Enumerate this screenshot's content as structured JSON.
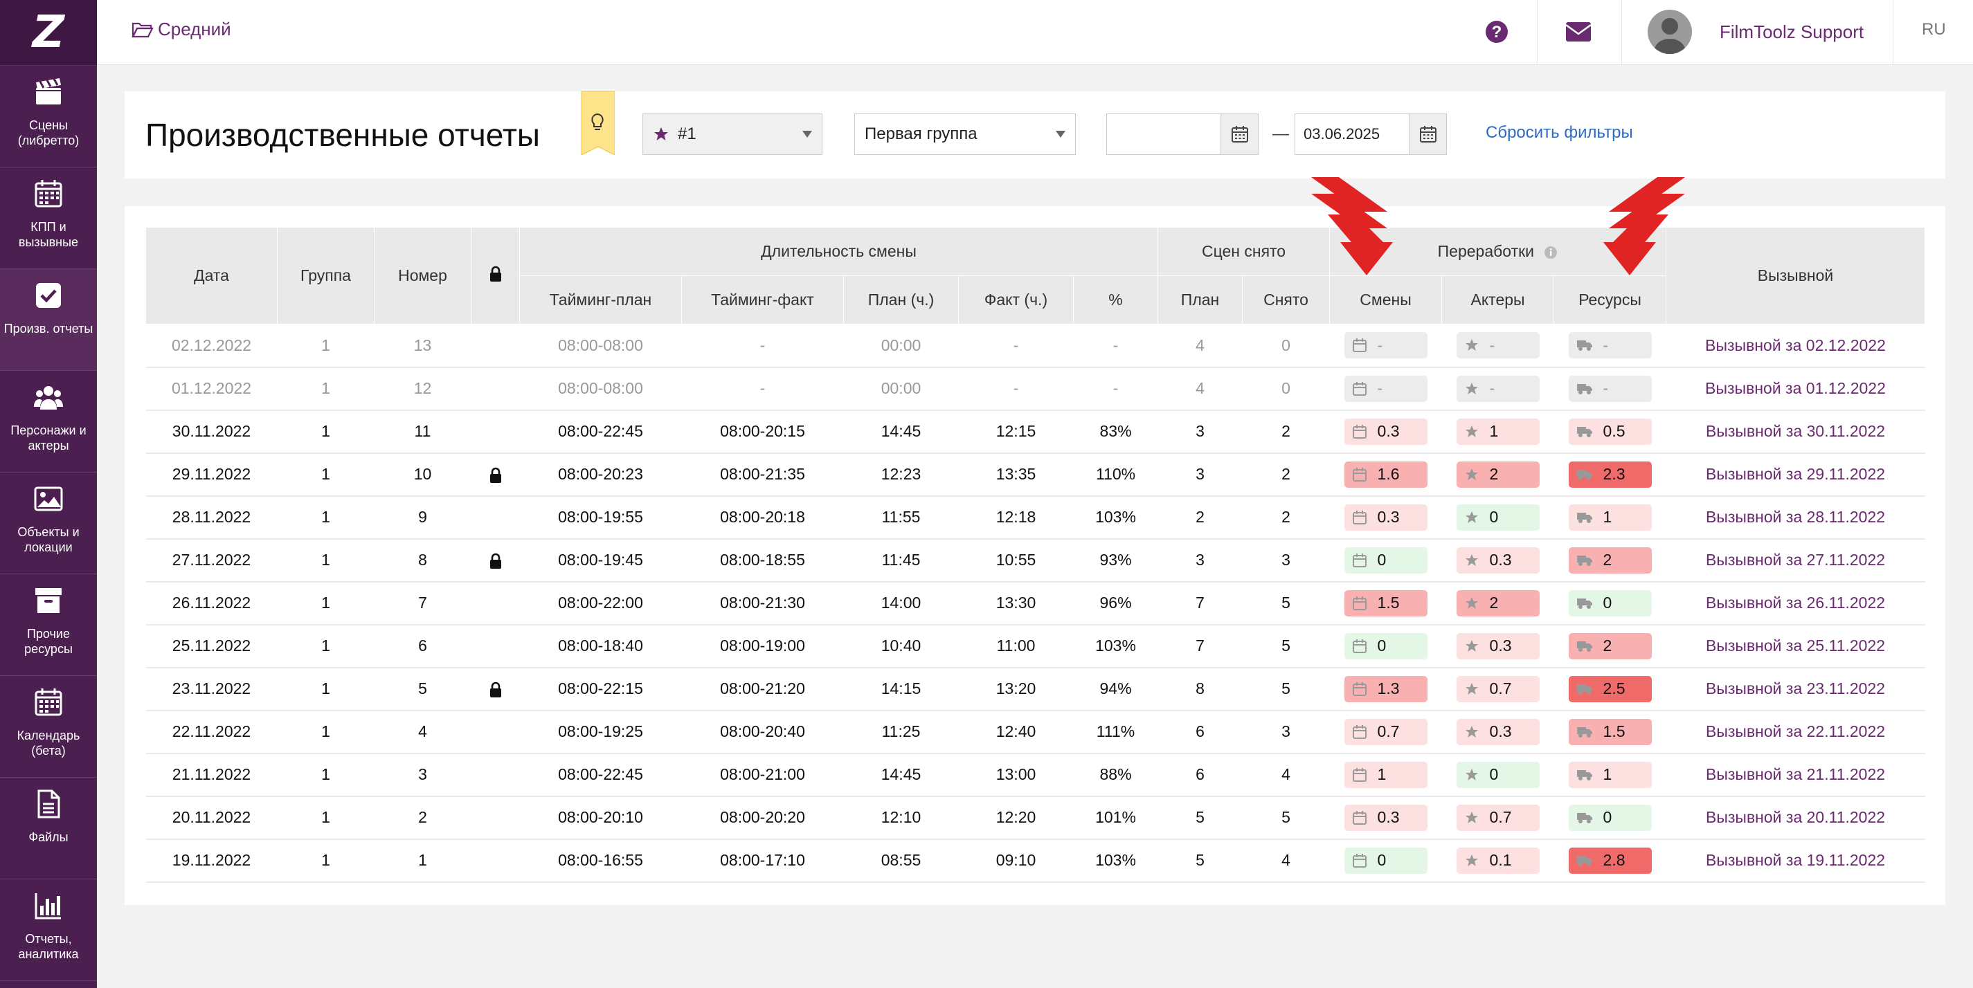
{
  "sidebar": {
    "logo": "Z",
    "items": [
      {
        "label": "Сцены\n(либретто)",
        "icon": "clapperboard-icon"
      },
      {
        "label": "КПП и\nвызывные",
        "icon": "calendar-icon"
      },
      {
        "label": "Произв. отчеты",
        "icon": "checkbox-icon",
        "active": true
      },
      {
        "label": "Персонажи и\nактеры",
        "icon": "people-icon"
      },
      {
        "label": "Объекты и\nлокации",
        "icon": "image-icon"
      },
      {
        "label": "Прочие\nресурсы",
        "icon": "archive-icon"
      },
      {
        "label": "Календарь\n(бета)",
        "icon": "calendar-icon"
      },
      {
        "label": "Файлы",
        "icon": "file-icon"
      },
      {
        "label": "Отчеты,\nаналитика",
        "icon": "bar-chart-icon"
      }
    ]
  },
  "topbar": {
    "project": "Средний",
    "user_name": "FilmToolz Support",
    "lang": "RU"
  },
  "filters": {
    "title": "Производственные отчеты",
    "unit_select": "#1",
    "group_select": "Первая группа",
    "date_from": "",
    "date_to": "03.06.2025",
    "dash": "—",
    "reset": "Сбросить фильтры"
  },
  "table": {
    "headers": {
      "date": "Дата",
      "group": "Группа",
      "number": "Номер",
      "duration": "Длительность смены",
      "timing_plan": "Тайминг-план",
      "timing_fact": "Тайминг-факт",
      "plan_h": "План (ч.)",
      "fact_h": "Факт (ч.)",
      "percent": "%",
      "scenes": "Сцен снято",
      "scenes_plan": "План",
      "scenes_done": "Снято",
      "overtime": "Переработки",
      "ot_shifts": "Смены",
      "ot_actors": "Актеры",
      "ot_resources": "Ресурсы",
      "callsheet": "Вызывной"
    },
    "rows": [
      {
        "date": "02.12.2022",
        "group": "1",
        "number": "13",
        "lock": false,
        "tplan": "08:00-08:00",
        "tfact": "-",
        "plan": "00:00",
        "fact": "-",
        "pct": "-",
        "sp": "4",
        "sd": "0",
        "s": "-",
        "a": "-",
        "r": "-",
        "sl": "gray",
        "al": "gray",
        "rl": "gray",
        "call": "Вызывной за 02.12.2022",
        "muted": true
      },
      {
        "date": "01.12.2022",
        "group": "1",
        "number": "12",
        "lock": false,
        "tplan": "08:00-08:00",
        "tfact": "-",
        "plan": "00:00",
        "fact": "-",
        "pct": "-",
        "sp": "4",
        "sd": "0",
        "s": "-",
        "a": "-",
        "r": "-",
        "sl": "gray",
        "al": "gray",
        "rl": "gray",
        "call": "Вызывной за 01.12.2022",
        "muted": true
      },
      {
        "date": "30.11.2022",
        "group": "1",
        "number": "11",
        "lock": false,
        "tplan": "08:00-22:45",
        "tfact": "08:00-20:15",
        "plan": "14:45",
        "fact": "12:15",
        "pct": "83%",
        "sp": "3",
        "sd": "2",
        "s": "0.3",
        "a": "1",
        "r": "0.5",
        "sl": "light",
        "al": "light",
        "rl": "light",
        "call": "Вызывной за 30.11.2022"
      },
      {
        "date": "29.11.2022",
        "group": "1",
        "number": "10",
        "lock": true,
        "tplan": "08:00-20:23",
        "tfact": "08:00-21:35",
        "plan": "12:23",
        "fact": "13:35",
        "pct": "110%",
        "sp": "3",
        "sd": "2",
        "s": "1.6",
        "a": "2",
        "r": "2.3",
        "sl": "mid",
        "al": "mid",
        "rl": "strong",
        "call": "Вызывной за 29.11.2022"
      },
      {
        "date": "28.11.2022",
        "group": "1",
        "number": "9",
        "lock": false,
        "tplan": "08:00-19:55",
        "tfact": "08:00-20:18",
        "plan": "11:55",
        "fact": "12:18",
        "pct": "103%",
        "sp": "2",
        "sd": "2",
        "s": "0.3",
        "a": "0",
        "r": "1",
        "sl": "light",
        "al": "green",
        "rl": "light",
        "call": "Вызывной за 28.11.2022"
      },
      {
        "date": "27.11.2022",
        "group": "1",
        "number": "8",
        "lock": true,
        "tplan": "08:00-19:45",
        "tfact": "08:00-18:55",
        "plan": "11:45",
        "fact": "10:55",
        "pct": "93%",
        "sp": "3",
        "sd": "3",
        "s": "0",
        "a": "0.3",
        "r": "2",
        "sl": "green",
        "al": "light",
        "rl": "mid",
        "call": "Вызывной за 27.11.2022"
      },
      {
        "date": "26.11.2022",
        "group": "1",
        "number": "7",
        "lock": false,
        "tplan": "08:00-22:00",
        "tfact": "08:00-21:30",
        "plan": "14:00",
        "fact": "13:30",
        "pct": "96%",
        "sp": "7",
        "sd": "5",
        "s": "1.5",
        "a": "2",
        "r": "0",
        "sl": "mid",
        "al": "mid",
        "rl": "green",
        "call": "Вызывной за 26.11.2022"
      },
      {
        "date": "25.11.2022",
        "group": "1",
        "number": "6",
        "lock": false,
        "tplan": "08:00-18:40",
        "tfact": "08:00-19:00",
        "plan": "10:40",
        "fact": "11:00",
        "pct": "103%",
        "sp": "7",
        "sd": "5",
        "s": "0",
        "a": "0.3",
        "r": "2",
        "sl": "green",
        "al": "light",
        "rl": "mid",
        "call": "Вызывной за 25.11.2022"
      },
      {
        "date": "23.11.2022",
        "group": "1",
        "number": "5",
        "lock": true,
        "tplan": "08:00-22:15",
        "tfact": "08:00-21:20",
        "plan": "14:15",
        "fact": "13:20",
        "pct": "94%",
        "sp": "8",
        "sd": "5",
        "s": "1.3",
        "a": "0.7",
        "r": "2.5",
        "sl": "mid",
        "al": "light",
        "rl": "strong",
        "call": "Вызывной за 23.11.2022"
      },
      {
        "date": "22.11.2022",
        "group": "1",
        "number": "4",
        "lock": false,
        "tplan": "08:00-19:25",
        "tfact": "08:00-20:40",
        "plan": "11:25",
        "fact": "12:40",
        "pct": "111%",
        "sp": "6",
        "sd": "3",
        "s": "0.7",
        "a": "0.3",
        "r": "1.5",
        "sl": "light",
        "al": "light",
        "rl": "mid",
        "call": "Вызывной за 22.11.2022"
      },
      {
        "date": "21.11.2022",
        "group": "1",
        "number": "3",
        "lock": false,
        "tplan": "08:00-22:45",
        "tfact": "08:00-21:00",
        "plan": "14:45",
        "fact": "13:00",
        "pct": "88%",
        "sp": "6",
        "sd": "4",
        "s": "1",
        "a": "0",
        "r": "1",
        "sl": "light",
        "al": "green",
        "rl": "light",
        "call": "Вызывной за 21.11.2022"
      },
      {
        "date": "20.11.2022",
        "group": "1",
        "number": "2",
        "lock": false,
        "tplan": "08:00-20:10",
        "tfact": "08:00-20:20",
        "plan": "12:10",
        "fact": "12:20",
        "pct": "101%",
        "sp": "5",
        "sd": "5",
        "s": "0.3",
        "a": "0.7",
        "r": "0",
        "sl": "light",
        "al": "light",
        "rl": "green",
        "call": "Вызывной за 20.11.2022"
      },
      {
        "date": "19.11.2022",
        "group": "1",
        "number": "1",
        "lock": false,
        "tplan": "08:00-16:55",
        "tfact": "08:00-17:10",
        "plan": "08:55",
        "fact": "09:10",
        "pct": "103%",
        "sp": "5",
        "sd": "4",
        "s": "0",
        "a": "0.1",
        "r": "2.8",
        "sl": "green",
        "al": "light",
        "rl": "strong",
        "call": "Вызывной за 19.11.2022"
      }
    ]
  },
  "colors": {
    "brand": "#4b1f4f",
    "link": "#6a2a6f",
    "reset_link": "#2d6cc5",
    "arrow": "#e02424"
  }
}
